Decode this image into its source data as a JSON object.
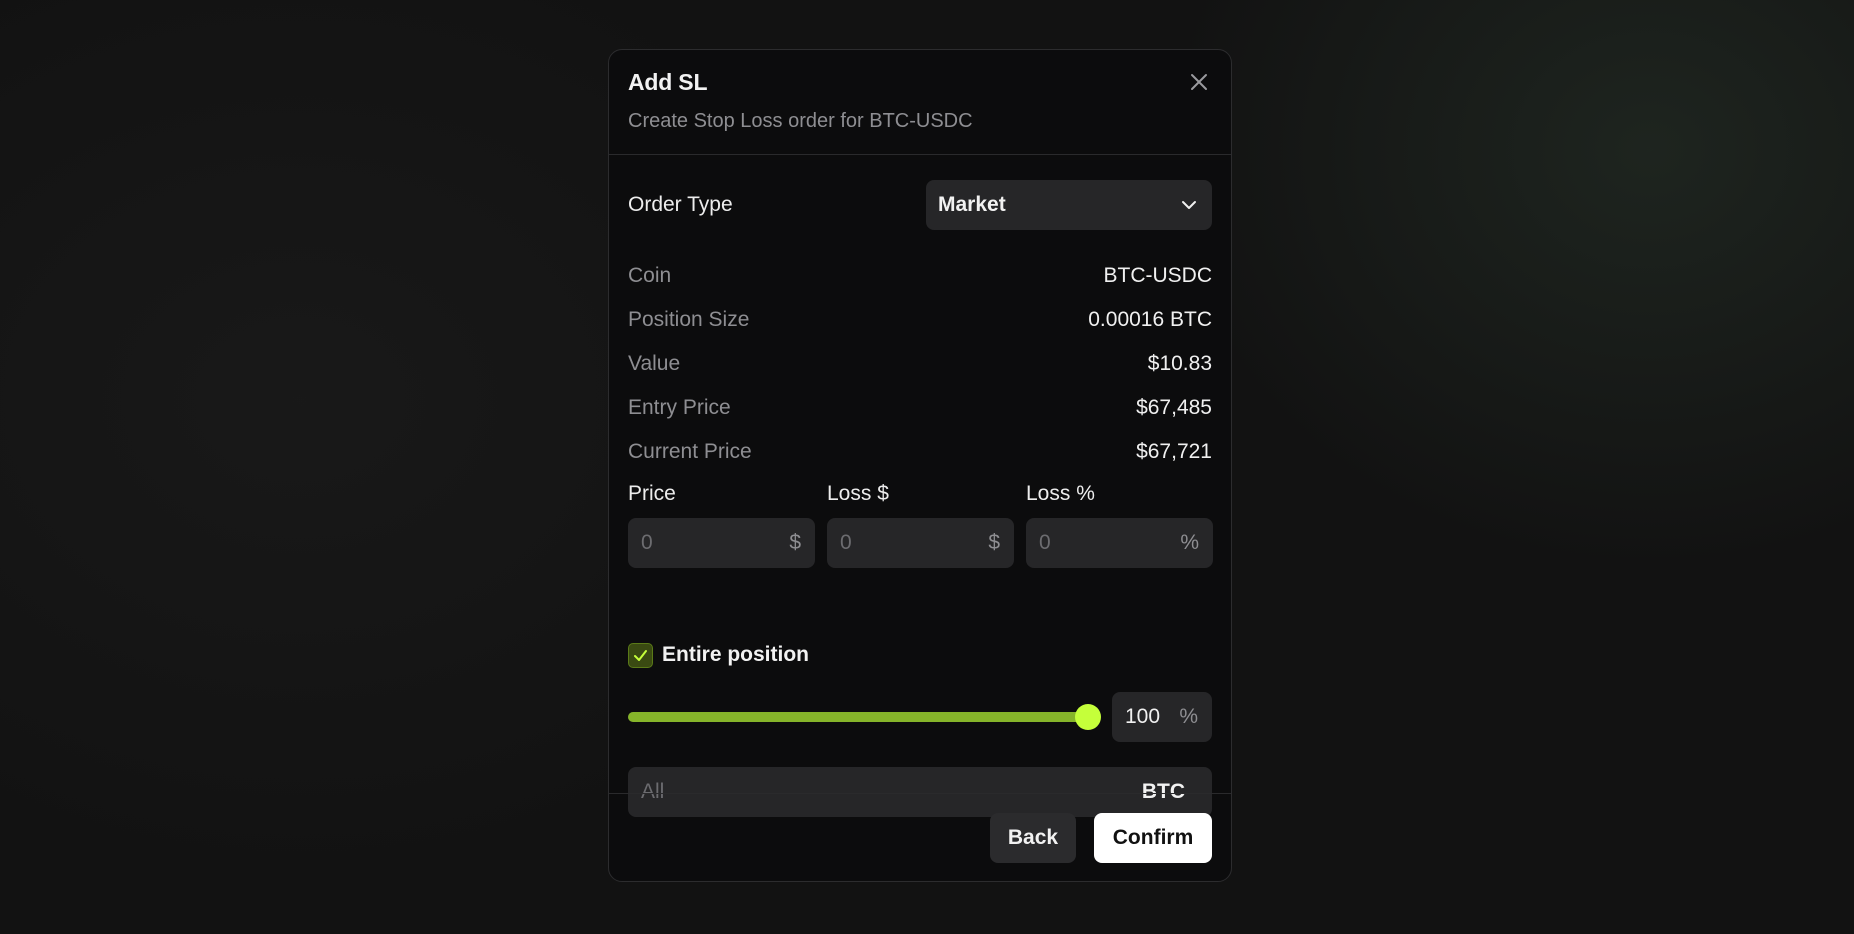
{
  "dialog": {
    "title": "Add SL",
    "subtitle": "Create Stop Loss order for BTC-USDC",
    "close_icon": "close-icon"
  },
  "order_type": {
    "label": "Order Type",
    "selected": "Market"
  },
  "info": [
    {
      "label": "Coin",
      "value": "BTC-USDC"
    },
    {
      "label": "Position Size",
      "value": "0.00016 BTC"
    },
    {
      "label": "Value",
      "value": "$10.83"
    },
    {
      "label": "Entry Price",
      "value": "$67,485"
    },
    {
      "label": "Current Price",
      "value": "$67,721"
    }
  ],
  "inputs": {
    "price": {
      "label": "Price",
      "placeholder": "0",
      "suffix": "$"
    },
    "loss_usd": {
      "label": "Loss $",
      "placeholder": "0",
      "suffix": "$"
    },
    "loss_pct": {
      "label": "Loss %",
      "placeholder": "0",
      "suffix": "%"
    }
  },
  "entire_position": {
    "label": "Entire position",
    "checked": true
  },
  "size_slider": {
    "percent": 100,
    "value_text": "100",
    "suffix": "%"
  },
  "amount": {
    "placeholder": "All",
    "unit": "BTC"
  },
  "buttons": {
    "back": "Back",
    "confirm": "Confirm"
  },
  "colors": {
    "accent": "#c5ff3a",
    "slider_fill": "#86b52a",
    "surface": "#262628",
    "dialog_bg": "#0c0c0d"
  }
}
